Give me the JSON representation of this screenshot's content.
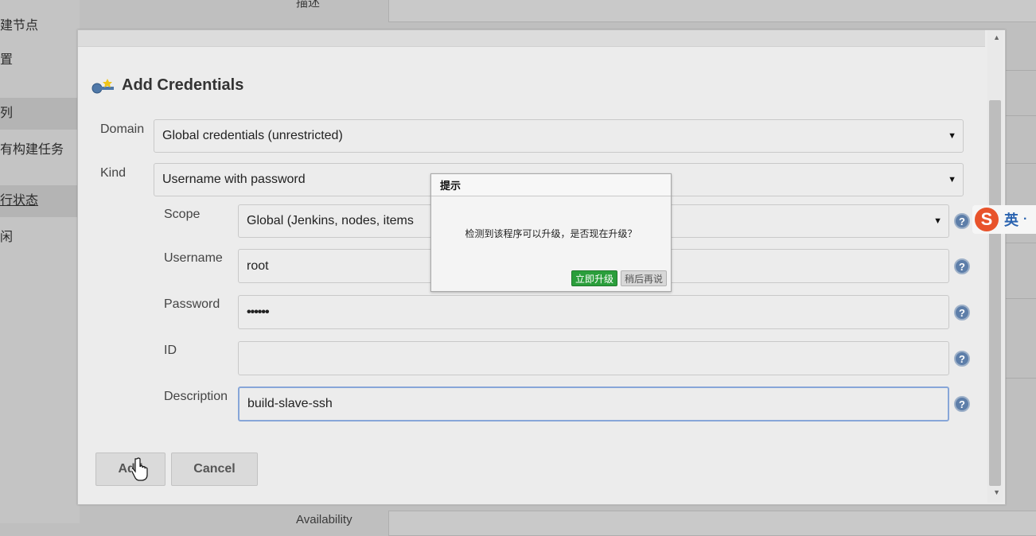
{
  "background": {
    "sidebar_items": [
      "建节点",
      "置",
      "列",
      "有构建任务",
      "行状态",
      "闲"
    ],
    "top_label": "描述",
    "bottom_label": "Availability"
  },
  "modal": {
    "title": "Add Credentials",
    "domain": {
      "label": "Domain",
      "value": "Global credentials (unrestricted)"
    },
    "kind": {
      "label": "Kind",
      "value": "Username with password"
    },
    "scope": {
      "label": "Scope",
      "value": "Global (Jenkins, nodes, items"
    },
    "username": {
      "label": "Username",
      "value": "root"
    },
    "password": {
      "label": "Password",
      "value": "••••••"
    },
    "id": {
      "label": "ID",
      "value": ""
    },
    "description": {
      "label": "Description",
      "value": "build-slave-ssh"
    },
    "help_glyph": "?",
    "buttons": {
      "add": "Add",
      "cancel": "Cancel"
    }
  },
  "dialog": {
    "title": "提示",
    "message": "检测到该程序可以升级，是否现在升级？",
    "ok": "立即升级",
    "later": "稍后再说"
  },
  "ime": {
    "logo": "S",
    "lang": "英",
    "punct": "·"
  },
  "colors": {
    "dialog_ok_bg": "#2a9e3b",
    "help_icon": "#5d7ea9",
    "focus_border": "#87a6d8"
  }
}
